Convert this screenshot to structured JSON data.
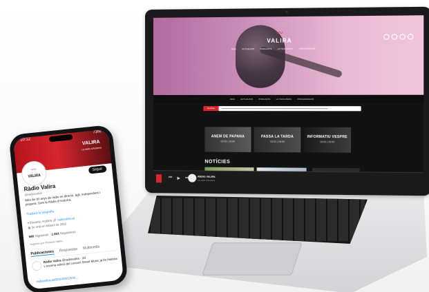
{
  "laptop": {
    "logo": "VALIRA",
    "top_nav": [
      "INICI",
      "ACTUALITAT",
      "PODCASTS",
      "LA TEVA RÀDIO",
      "PROGRAMACIÓ"
    ],
    "main_nav": [
      "INICI",
      "ACTUALITAT",
      "PODCASTS",
      "LA TEVA RÀDIO",
      "PROGRAMACIÓ"
    ],
    "ticker_tag": "Notícies",
    "shows": [
      {
        "title": "ANEM DE PAPANA",
        "hours": "09:00 | 10:00"
      },
      {
        "title": "PASSA LA TARDA",
        "hours": "15:00 | 18:00"
      },
      {
        "title": "INFORMATIU VESPRE",
        "hours": "19:00 | 20:00"
      }
    ],
    "section_title": "NOTÍCIES",
    "player": {
      "name": "RÀDIO VALIRA",
      "sub": "La ràdio d'Andorra"
    }
  },
  "phone": {
    "time": "10:12",
    "battery": "73%",
    "banner_logo": "VALIRA",
    "avatar_label": "VALIRA",
    "follow_label": "Seguir",
    "name": "Ràdio Valira",
    "handle": "@radiovalira",
    "bio": "Més de 30 anys de ràdio en directe, àgil, independent i propera. Som la Ràdio d'Andorra.",
    "see_translation": "Traducir la biografía",
    "location": "Encamp, Andorra",
    "website": "radiovalira.ad",
    "joined": "Se unió en febrero de 2010",
    "following_count": "660",
    "following_label": "Siguiendo",
    "followers_count": "1.553",
    "followers_label": "Seguidores",
    "followed_by": "Seguido por Premsa Valira",
    "tabs": [
      "Publicaciones",
      "Respuestas",
      "Multimedia"
    ],
    "tweet_author": "Ràdio Valira",
    "tweet_handle": "@radiovalira · 2d",
    "tweet_text": "L'escena edició del concert Street Music ja és història",
    "tweet_link": "radiovalira.ad/2024/06/15/str..."
  },
  "colors": {
    "brand_red": "#d8262e",
    "link_blue": "#1d8de8",
    "hero_pink": "#e9b8d4"
  }
}
